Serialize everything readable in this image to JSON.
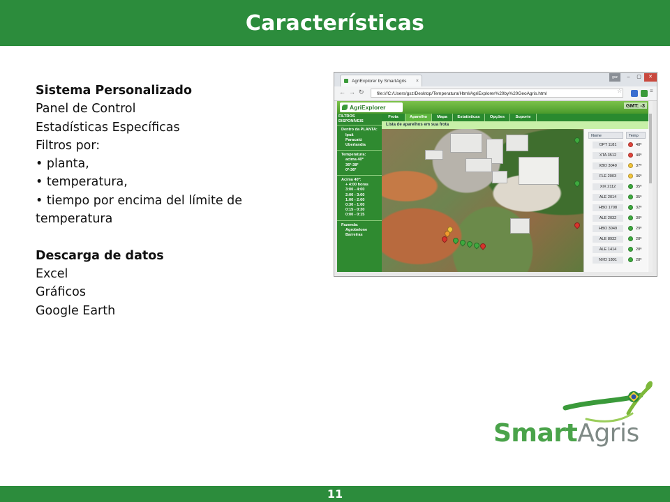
{
  "slide": {
    "title": "Características",
    "page_number": "11"
  },
  "content": {
    "heading1": "Sistema Personalizado",
    "line_panel": "Panel de Control",
    "line_stats": "Estadísticas Específicas",
    "line_filters": "Filtros por:",
    "bullet_plant": "planta,",
    "bullet_temp": "temperatura,",
    "bullet_time_1": "tiempo por encima del límite de",
    "bullet_time_2": "temperatura",
    "heading2": "Descarga de datos",
    "dl_excel": "Excel",
    "dl_graphs": "Gráficos",
    "dl_earth": "Google Earth"
  },
  "screenshot": {
    "tab_title": "AgriExplorer by SmartAgris",
    "user_badge": "gsz",
    "url": "file:///C:/Users/gsz/Desktop/Temperatura/Html/AgriExplorer%20by%20GeoAgris.html",
    "app_name": "AgriExplorer",
    "gmt": "GMT: -3",
    "sidebar": {
      "header": "FILTROS DISPONÍVEIS",
      "plant_title": "Dentro da PLANTA:",
      "plants": [
        "Ipuã",
        "Paracatú",
        "Uberlandia"
      ],
      "temp_title": "Temperatura:",
      "temps": [
        "acima 40º",
        "36º-38º",
        "0º-36º"
      ],
      "above_title": "Acima 40º:",
      "above": [
        "+ 4:00 horas",
        "3:00 - 4:00",
        "2:00 - 3:00",
        "1:00 - 2:00",
        "0:30 - 1:00",
        "0:15 - 0:30",
        "0:00 - 0:15"
      ],
      "farm_title": "Fazenda:",
      "farms": [
        "Agrobelone",
        "Barreiras"
      ]
    },
    "menu": [
      "Frota",
      "Aparelho",
      "Mapa",
      "Estatísticas",
      "Opções",
      "Suporte"
    ],
    "active_menu": "Aparelho",
    "subtitle": "Lista de aparelhos em sua frota",
    "list_headers": {
      "name": "Nome",
      "temp": "Temp"
    },
    "devices": [
      {
        "name": "OPT 1181",
        "temp": "48º",
        "status": "red"
      },
      {
        "name": "XTA 3512",
        "temp": "40º",
        "status": "red"
      },
      {
        "name": "XBO 3049",
        "temp": "37º",
        "status": "yellow"
      },
      {
        "name": "FLE 2003",
        "temp": "36º",
        "status": "yellow"
      },
      {
        "name": "XIX 2112",
        "temp": "35º",
        "status": "green"
      },
      {
        "name": "ALE 2014",
        "temp": "35º",
        "status": "green"
      },
      {
        "name": "HBO 1708",
        "temp": "32º",
        "status": "green"
      },
      {
        "name": "ALE 2032",
        "temp": "30º",
        "status": "green"
      },
      {
        "name": "HBO 3049",
        "temp": "29º",
        "status": "green"
      },
      {
        "name": "ALE 8932",
        "temp": "28º",
        "status": "green"
      },
      {
        "name": "ALE 1414",
        "temp": "28º",
        "status": "green"
      },
      {
        "name": "NYD 1801",
        "temp": "28º",
        "status": "green"
      }
    ]
  },
  "brand": {
    "logo_smart": "Smart",
    "logo_agris": "Agris"
  },
  "colors": {
    "bar_green": "#2c8c3c",
    "status_red": "#e0463c",
    "status_yellow": "#f2c43a",
    "status_green": "#3eaa3e"
  }
}
